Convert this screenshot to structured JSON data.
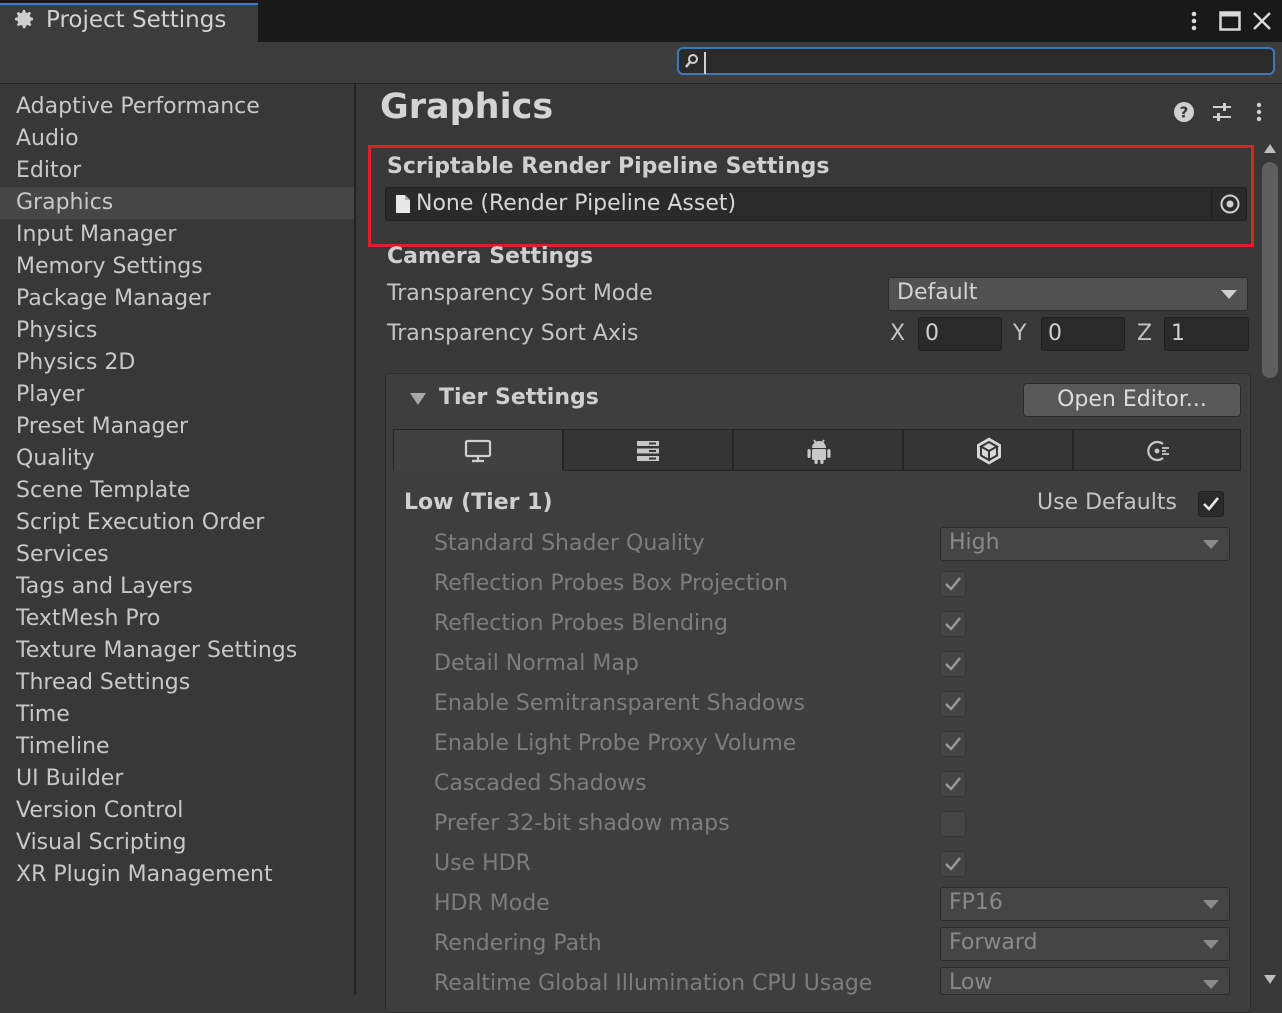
{
  "window": {
    "tab_title": "Project Settings",
    "tab_icon": "gear-icon",
    "buttons": [
      "more-vert-icon",
      "maximize-icon",
      "close-icon"
    ]
  },
  "search": {
    "value": "",
    "placeholder": ""
  },
  "sidebar": {
    "selected": "Graphics",
    "items": [
      "Adaptive Performance",
      "Audio",
      "Editor",
      "Graphics",
      "Input Manager",
      "Memory Settings",
      "Package Manager",
      "Physics",
      "Physics 2D",
      "Player",
      "Preset Manager",
      "Quality",
      "Scene Template",
      "Script Execution Order",
      "Services",
      "Tags and Layers",
      "TextMesh Pro",
      "Texture Manager Settings",
      "Thread Settings",
      "Time",
      "Timeline",
      "UI Builder",
      "Version Control",
      "Visual Scripting",
      "XR Plugin Management"
    ]
  },
  "main": {
    "title": "Graphics",
    "header_icons": [
      "help-icon",
      "preset-sliders-icon",
      "more-vert-icon"
    ],
    "srp": {
      "title": "Scriptable Render Pipeline Settings",
      "field_value": "None (Render Pipeline Asset)"
    },
    "camera": {
      "title": "Camera Settings",
      "sort_mode_label": "Transparency Sort Mode",
      "sort_mode_value": "Default",
      "sort_axis_label": "Transparency Sort Axis",
      "axis": {
        "x_label": "X",
        "x": "0",
        "y_label": "Y",
        "y": "0",
        "z_label": "Z",
        "z": "1"
      }
    },
    "tier": {
      "title": "Tier Settings",
      "open_editor": "Open Editor...",
      "platform_tabs": [
        "standalone-monitor-icon",
        "server-icon",
        "android-icon",
        "webgl-icon",
        "embedded-linux-icon"
      ],
      "tier_name": "Low (Tier 1)",
      "use_defaults_label": "Use Defaults",
      "use_defaults": true,
      "rows": [
        {
          "label": "Standard Shader Quality",
          "type": "dropdown",
          "value": "High"
        },
        {
          "label": "Reflection Probes Box Projection",
          "type": "check",
          "checked": true
        },
        {
          "label": "Reflection Probes Blending",
          "type": "check",
          "checked": true
        },
        {
          "label": "Detail Normal Map",
          "type": "check",
          "checked": true
        },
        {
          "label": "Enable Semitransparent Shadows",
          "type": "check",
          "checked": true
        },
        {
          "label": "Enable Light Probe Proxy Volume",
          "type": "check",
          "checked": true
        },
        {
          "label": "Cascaded Shadows",
          "type": "check",
          "checked": true
        },
        {
          "label": "Prefer 32-bit shadow maps",
          "type": "check",
          "checked": false
        },
        {
          "label": "Use HDR",
          "type": "check",
          "checked": true
        },
        {
          "label": "HDR Mode",
          "type": "dropdown",
          "value": "FP16"
        },
        {
          "label": "Rendering Path",
          "type": "dropdown",
          "value": "Forward"
        },
        {
          "label": "Realtime Global Illumination CPU Usage",
          "type": "dropdown",
          "value": "Low"
        }
      ]
    }
  },
  "colors": {
    "highlight_border": "#e01f2a",
    "search_focus": "#3a79bb"
  }
}
